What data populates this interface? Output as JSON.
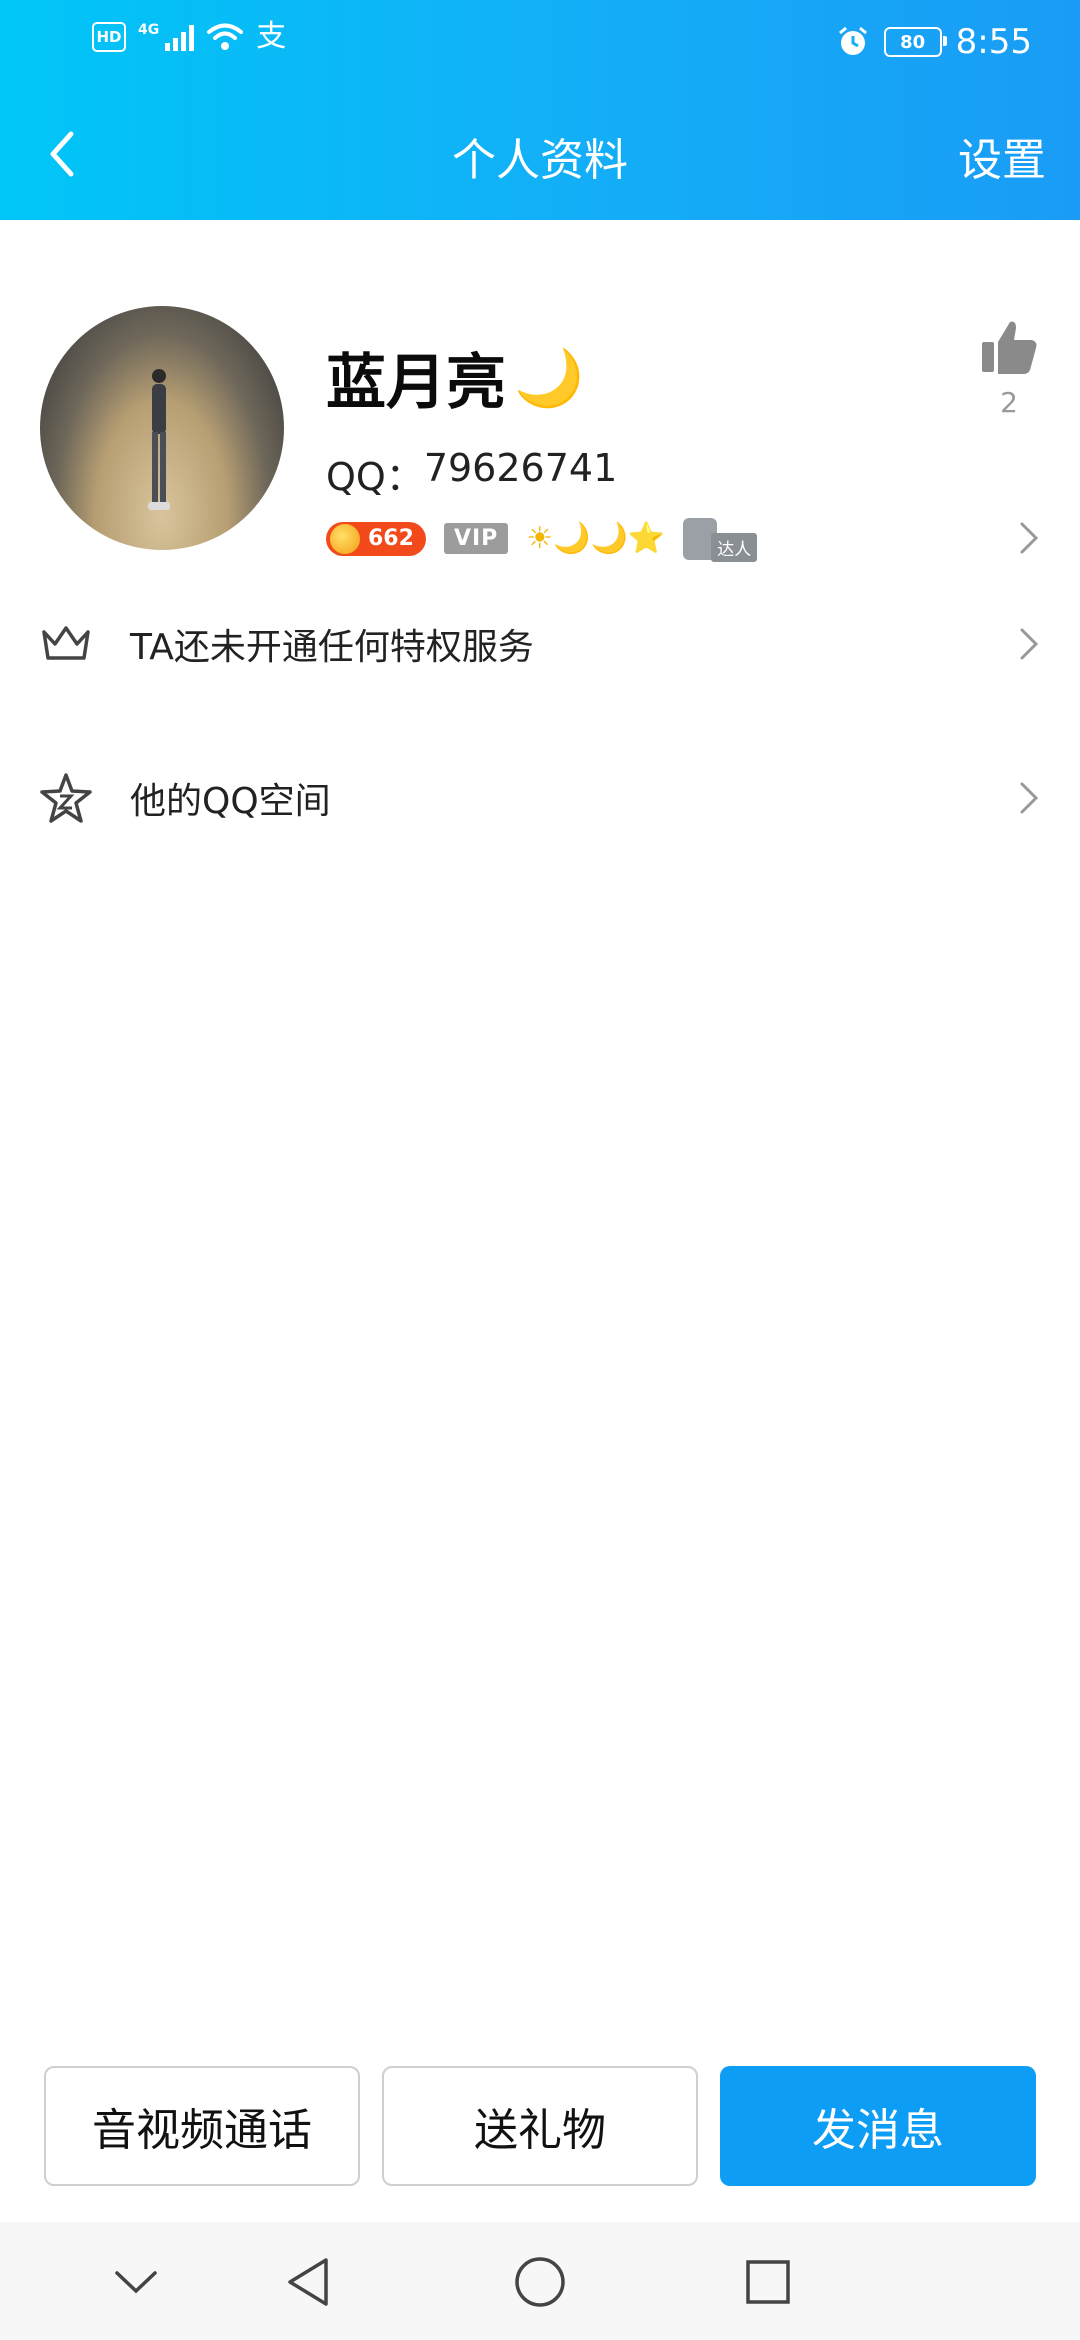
{
  "status_bar": {
    "hd": "HD",
    "network": "4G",
    "pay_glyph": "支",
    "battery": "80",
    "time": "8:55"
  },
  "header": {
    "title": "个人资料",
    "settings_label": "设置"
  },
  "profile": {
    "nickname": "蓝月亮",
    "nickname_emoji": "🌙",
    "qq_label": "QQ：",
    "qq_number": "79626741",
    "coin_count": "662",
    "vip_label": "VIP",
    "level_icons": "☀🌙🌙⭐",
    "talent_label": "达人",
    "like_count": "2"
  },
  "list": [
    {
      "label": "TA还未开通任何特权服务",
      "icon": "crown-icon"
    },
    {
      "label": "他的QQ空间",
      "icon": "star-icon"
    }
  ],
  "actions": {
    "call": "音视频通话",
    "gift": "送礼物",
    "message": "发消息"
  },
  "colors": {
    "header_start": "#00c6f7",
    "header_end": "#1a9cf6",
    "primary_button": "#0d9df5",
    "coin_badge": "#f24a1a"
  }
}
